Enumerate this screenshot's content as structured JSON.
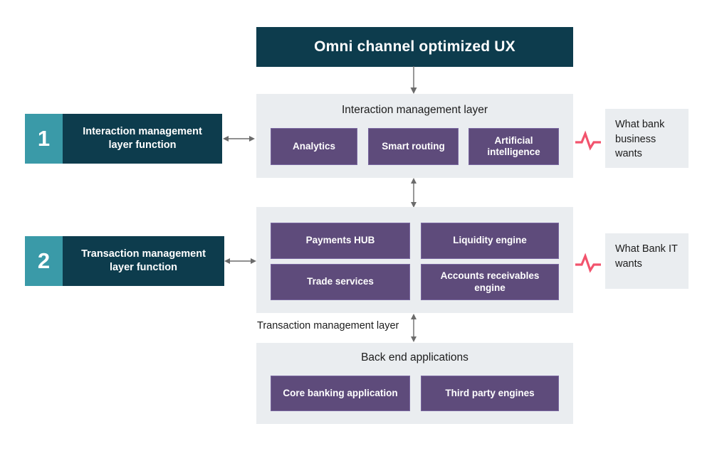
{
  "diagram": {
    "title": "Omni channel optimized UX",
    "floating_label": "Transaction management layer"
  },
  "layers": {
    "interaction": {
      "title": "Interaction management layer",
      "chips": [
        {
          "label": "Analytics"
        },
        {
          "label": "Smart routing"
        },
        {
          "label": "Artificial intelligence"
        }
      ]
    },
    "transaction": {
      "title": "",
      "chips": [
        {
          "label": "Payments  HUB"
        },
        {
          "label": "Liquidity engine"
        },
        {
          "label": "Trade services"
        },
        {
          "label": "Accounts receivables engine"
        }
      ]
    },
    "backend": {
      "title": "Back end applications",
      "chips": [
        {
          "label": "Core banking application"
        },
        {
          "label": "Third party engines"
        }
      ]
    }
  },
  "functions": [
    {
      "number": "1",
      "label": "Interaction management layer function"
    },
    {
      "number": "2",
      "label": "Transaction management layer function"
    }
  ],
  "wants": [
    {
      "text": "What bank business wants",
      "icon": "pulse-icon"
    },
    {
      "text": "What Bank IT wants",
      "icon": "pulse-icon"
    }
  ],
  "colors": {
    "dark_teal": "#0d3c4d",
    "badge_teal": "#3a9aa8",
    "purple": "#5e4b7b",
    "purple_border": "#7a68a0",
    "panel_gray": "#eaedf0",
    "pulse_pink": "#f2536d",
    "arrow_gray": "#6b6b6b",
    "text_dark": "#1c1c1c",
    "text_light": "#ffffff"
  }
}
